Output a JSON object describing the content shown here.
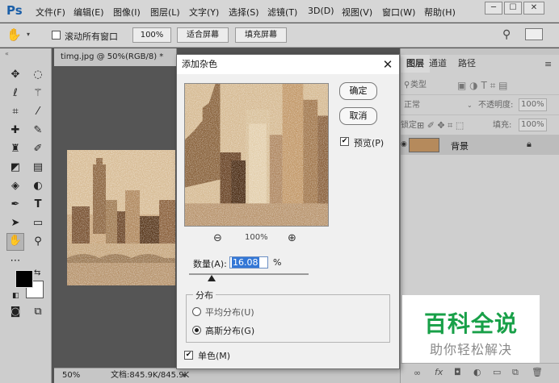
{
  "menubar": {
    "items": [
      "文件(F)",
      "编辑(E)",
      "图像(I)",
      "图层(L)",
      "文字(Y)",
      "选择(S)",
      "滤镜(T)",
      "3D(D)",
      "视图(V)",
      "窗口(W)",
      "帮助(H)"
    ]
  },
  "optionsbar": {
    "scroll_all_label": "滚动所有窗口",
    "zoom_100": "100%",
    "fit_screen": "适合屏幕",
    "fill_screen": "填充屏幕"
  },
  "document": {
    "tab_title": "timg.jpg @ 50%(RGB/8) *",
    "status_zoom": "50%",
    "status_doc": "文档:845.9K/845.9K"
  },
  "panel": {
    "tabs": [
      "图层",
      "通道",
      "路径"
    ],
    "kind_label": "类型",
    "blend_mode": "正常",
    "opacity_label": "不透明度:",
    "opacity_value": "100%",
    "lock_label": "锁定:",
    "fill_label": "填充:",
    "fill_value": "100%",
    "layer_name": "背景"
  },
  "dialog": {
    "title": "添加杂色",
    "ok": "确定",
    "cancel": "取消",
    "preview_label": "预览(P)",
    "preview_checked": true,
    "zoom_value": "100%",
    "amount_label": "数量(A):",
    "amount_value": "16.08",
    "amount_unit": "%",
    "distribution_label": "分布",
    "uniform_label": "平均分布(U)",
    "gaussian_label": "高斯分布(G)",
    "selected_distribution": "gaussian",
    "mono_label": "单色(M)",
    "mono_checked": true
  },
  "watermark": {
    "title": "百科全说",
    "subtitle": "助你轻松解决"
  },
  "colors": {
    "accent": "#18a048",
    "selection": "#3377d6"
  }
}
